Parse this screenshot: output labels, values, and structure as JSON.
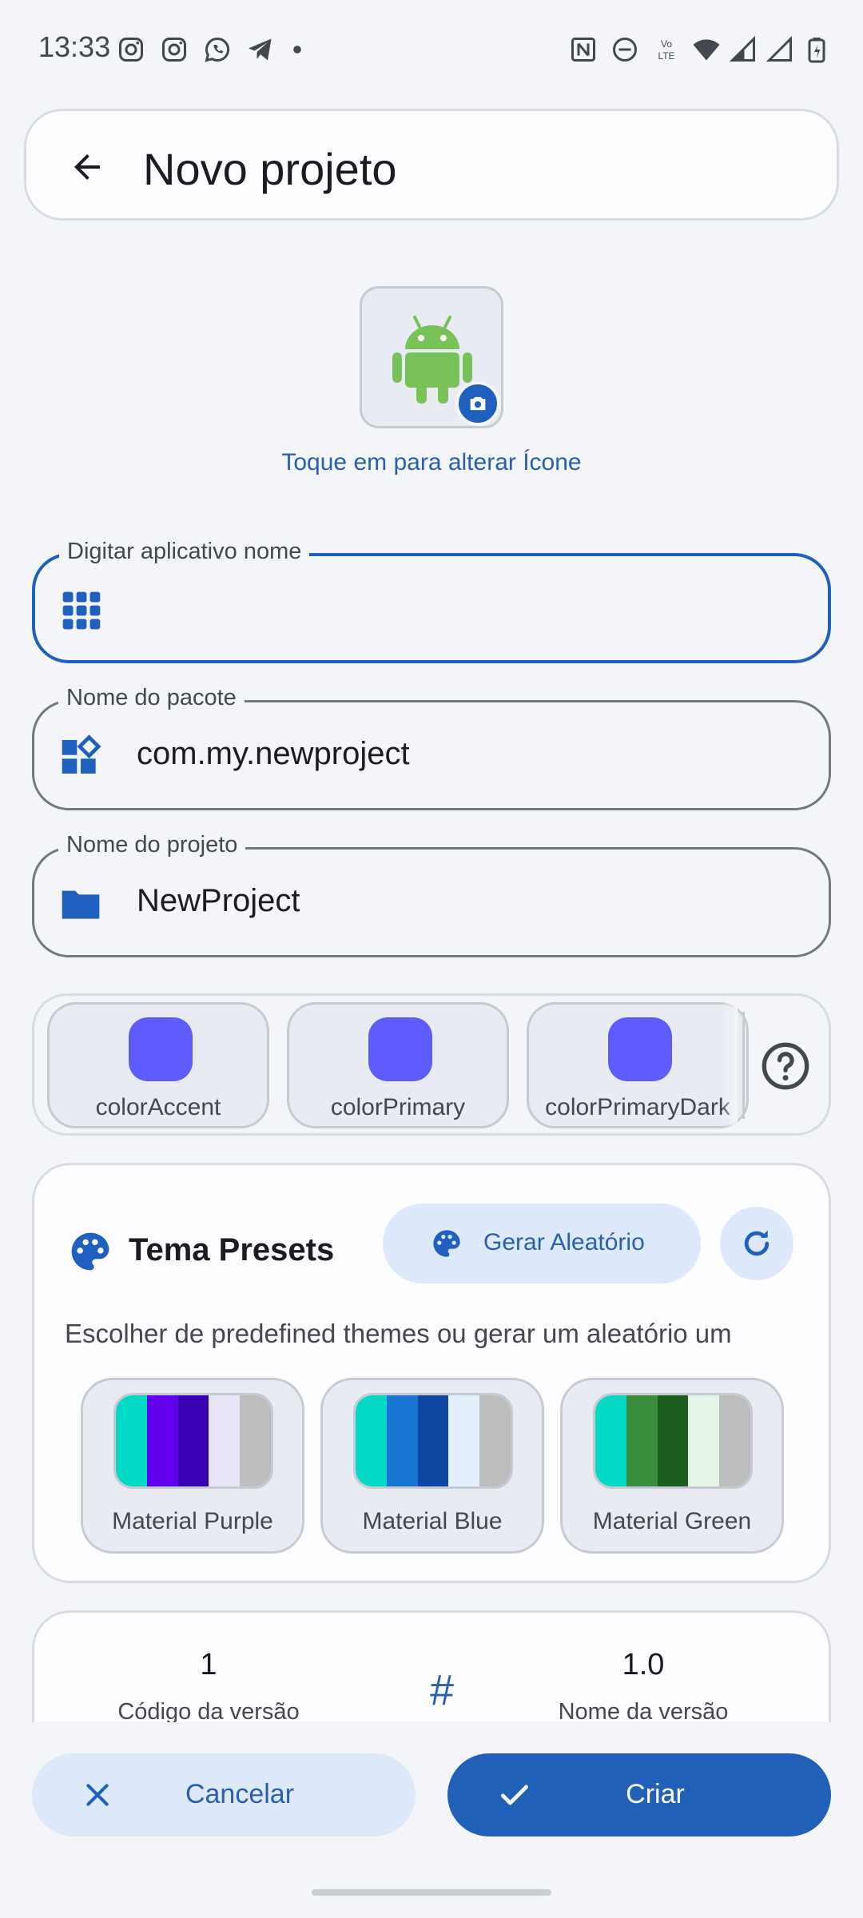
{
  "status_bar": {
    "time": "13:33",
    "left_icons": [
      "instagram-icon",
      "instagram-icon",
      "whatsapp-icon",
      "telegram-icon",
      "dot-icon"
    ],
    "right_icons": [
      "nfc-icon",
      "dnd-icon",
      "volte-icon",
      "wifi-icon",
      "signal-icon",
      "signal-icon",
      "battery-icon"
    ]
  },
  "app_bar": {
    "title": "Novo projeto",
    "back_icon": "arrow-back-icon"
  },
  "app_icon": {
    "image": "android-robot-icon",
    "badge_icon": "camera-icon",
    "hint": "Toque em para alterar Ícone"
  },
  "fields": {
    "app_name": {
      "label": "Digitar aplicativo nome",
      "value": "",
      "icon": "apps-grid-icon"
    },
    "package_name": {
      "label": "Nome do pacote",
      "value": "com.my.newproject",
      "icon": "widgets-icon"
    },
    "project_name": {
      "label": "Nome do projeto",
      "value": "NewProject",
      "icon": "folder-icon"
    }
  },
  "colors": {
    "items": [
      {
        "label": "colorAccent",
        "color": "#5f5cff"
      },
      {
        "label": "colorPrimary",
        "color": "#5f5cff"
      },
      {
        "label": "colorPrimaryDark",
        "color": "#5f5cff"
      }
    ],
    "help_icon": "help-circle-icon"
  },
  "presets": {
    "title": "Tema Presets",
    "random_button": "Gerar Aleatório",
    "refresh_icon": "refresh-icon",
    "description": "Escolher de predefined themes ou gerar um aleatório um",
    "items": [
      {
        "label": "Material Purple",
        "colors": [
          "#03dac5",
          "#6200ee",
          "#3700b3",
          "#e8e6f6",
          "#bdbdbd"
        ]
      },
      {
        "label": "Material Blue",
        "colors": [
          "#03dac5",
          "#1976d2",
          "#0d47a1",
          "#e3f0fb",
          "#bdbdbd"
        ]
      },
      {
        "label": "Material Green",
        "colors": [
          "#03dac5",
          "#388e3c",
          "#1b5e20",
          "#e6f3e7",
          "#bdbdbd"
        ]
      }
    ]
  },
  "version": {
    "code_value": "1",
    "code_label": "Código da versão",
    "name_value": "1.0",
    "name_label": "Nome da versão",
    "icon": "#"
  },
  "actions": {
    "cancel": "Cancelar",
    "create": "Criar"
  },
  "theme": {
    "primary": "#2160b8",
    "primary_container": "#dde9fb",
    "background": "#f3f5f9",
    "android_green": "#78c257"
  }
}
